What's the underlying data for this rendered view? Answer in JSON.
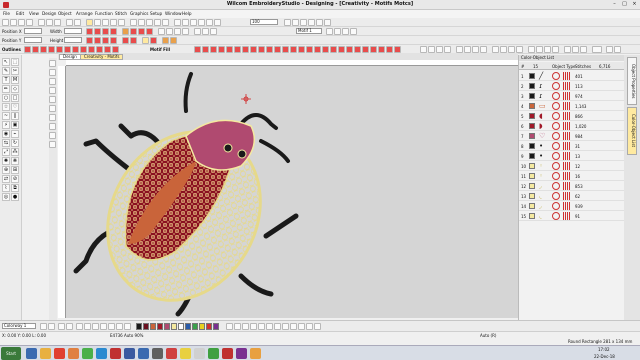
{
  "window": {
    "title": "Wilcom EmbroideryStudio - Designing - [Creativity - Motifs    Motcs]",
    "minimize": "–",
    "maximize": "□",
    "close": "×"
  },
  "menu": [
    "File",
    "Edit",
    "View",
    "Design",
    "Object",
    "Arrange",
    "Function",
    "Stitch",
    "Graphics",
    "Setup",
    "Window",
    "Help"
  ],
  "toolbar": {
    "zoom_value": "100",
    "method_value": "Motif 1",
    "position_x_label": "Position X",
    "position_y_label": "Position Y",
    "width_label": "Width",
    "height_label": "Height",
    "outlines_label": "Outlines",
    "motif_label": "Motif Fill"
  },
  "canvas": {
    "tabs": [
      "Design",
      "Creativity - Motifs"
    ]
  },
  "panel": {
    "title": "Color-Object List",
    "columns": [
      "#",
      "Object Type",
      "Stitches"
    ],
    "header_count": "15",
    "header_stitches": "6,716",
    "rows": [
      {
        "num": "1",
        "color": "#1a1a1a",
        "stitches": "401"
      },
      {
        "num": "2",
        "color": "#1a1a1a",
        "stitches": "113"
      },
      {
        "num": "3",
        "color": "#1a1a1a",
        "stitches": "974"
      },
      {
        "num": "4",
        "color": "#c9643a",
        "stitches": "1,143"
      },
      {
        "num": "5",
        "color": "#a01828",
        "stitches": "866"
      },
      {
        "num": "6",
        "color": "#a01828",
        "stitches": "1,020"
      },
      {
        "num": "7",
        "color": "#b04a70",
        "stitches": "984"
      },
      {
        "num": "8",
        "color": "#1a1a1a",
        "stitches": "31"
      },
      {
        "num": "9",
        "color": "#1a1a1a",
        "stitches": "13"
      },
      {
        "num": "10",
        "color": "#f4e9a0",
        "stitches": "12"
      },
      {
        "num": "11",
        "color": "#f4e9a0",
        "stitches": "16"
      },
      {
        "num": "12",
        "color": "#f4e9a0",
        "stitches": "853"
      },
      {
        "num": "13",
        "color": "#f4e9a0",
        "stitches": "62"
      },
      {
        "num": "14",
        "color": "#f4e9a0",
        "stitches": "939"
      },
      {
        "num": "15",
        "color": "#f4e9a0",
        "stitches": "91"
      }
    ],
    "vertical_tabs": [
      "Object Properties",
      "Color-Object List"
    ]
  },
  "colorbar": {
    "colorway_value": "Colorway 1",
    "palette": [
      "#1a1a1a",
      "#6b1020",
      "#c9643a",
      "#a01828",
      "#b04a70",
      "#f4e9a0",
      "#ffffff",
      "#2a5caa",
      "#3aa04a",
      "#e8d020",
      "#d03030",
      "#7a3090"
    ]
  },
  "status": {
    "coords": "X: 0.00 Y: 0.00 L: 0.00",
    "stitch_info": "E4736 Auto 90%",
    "zoom": "Auto (R)",
    "selection": "Round Rectangle 281 x 134 mm"
  },
  "taskbar": {
    "start_label": "Start",
    "time": "17:02",
    "date": "22-Dec-18"
  },
  "colors": {
    "accent": "#2a5caa",
    "canvas": "#d5d5d5",
    "bug_black": "#1a1a1a",
    "bug_red": "#a01828",
    "bug_pink": "#b04a70",
    "bug_gold": "#f4e9a0"
  }
}
